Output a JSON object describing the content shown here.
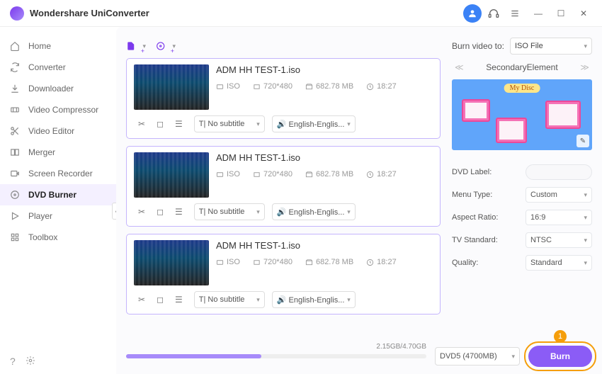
{
  "app": {
    "title": "Wondershare UniConverter"
  },
  "nav": {
    "items": [
      {
        "label": "Home",
        "icon": "home"
      },
      {
        "label": "Converter",
        "icon": "sync"
      },
      {
        "label": "Downloader",
        "icon": "download"
      },
      {
        "label": "Video Compressor",
        "icon": "compress"
      },
      {
        "label": "Video Editor",
        "icon": "scissors"
      },
      {
        "label": "Merger",
        "icon": "merge"
      },
      {
        "label": "Screen Recorder",
        "icon": "record"
      },
      {
        "label": "DVD Burner",
        "icon": "disc"
      },
      {
        "label": "Player",
        "icon": "play"
      },
      {
        "label": "Toolbox",
        "icon": "grid"
      }
    ],
    "active_index": 7
  },
  "toolbar": {
    "burn_to_label": "Burn video to:",
    "burn_to_value": "ISO File"
  },
  "items": [
    {
      "title": "ADM HH TEST-1.iso",
      "format": "ISO",
      "resolution": "720*480",
      "size": "682.78 MB",
      "duration": "18:27",
      "subtitle": "No subtitle",
      "audio": "English-Englis..."
    },
    {
      "title": "ADM HH TEST-1.iso",
      "format": "ISO",
      "resolution": "720*480",
      "size": "682.78 MB",
      "duration": "18:27",
      "subtitle": "No subtitle",
      "audio": "English-Englis..."
    },
    {
      "title": "ADM HH TEST-1.iso",
      "format": "ISO",
      "resolution": "720*480",
      "size": "682.78 MB",
      "duration": "18:27",
      "subtitle": "No subtitle",
      "audio": "English-Englis..."
    }
  ],
  "theme": {
    "name": "SecondaryElement",
    "disc_label": "My Disc"
  },
  "settings": {
    "dvd_label_label": "DVD Label:",
    "dvd_label_value": "",
    "menu_type_label": "Menu Type:",
    "menu_type_value": "Custom",
    "aspect_label": "Aspect Ratio:",
    "aspect_value": "16:9",
    "tv_label": "TV Standard:",
    "tv_value": "NTSC",
    "quality_label": "Quality:",
    "quality_value": "Standard"
  },
  "footer": {
    "used_total": "2.15GB/4.70GB",
    "disc_type": "DVD5 (4700MB)",
    "burn_label": "Burn",
    "callout_number": "1"
  }
}
